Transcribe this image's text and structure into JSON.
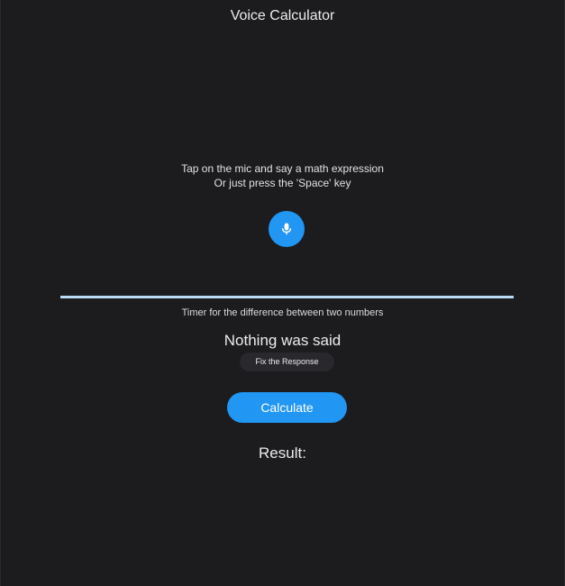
{
  "app": {
    "title": "Voice Calculator"
  },
  "instructions": {
    "line1": "Tap on the mic and say a math expression",
    "line2": "Or just press the 'Space' key"
  },
  "mic": {
    "icon": "microphone-icon",
    "color": "#2196f3"
  },
  "timer": {
    "progress": 1.0,
    "label": "Timer for the difference between two numbers",
    "color": "#bcd9f3"
  },
  "speech": {
    "text": "Nothing was said"
  },
  "fix_button": {
    "label": "Fix the Response"
  },
  "calculate_button": {
    "label": "Calculate",
    "color": "#2196f3"
  },
  "result": {
    "label": "Result:"
  }
}
